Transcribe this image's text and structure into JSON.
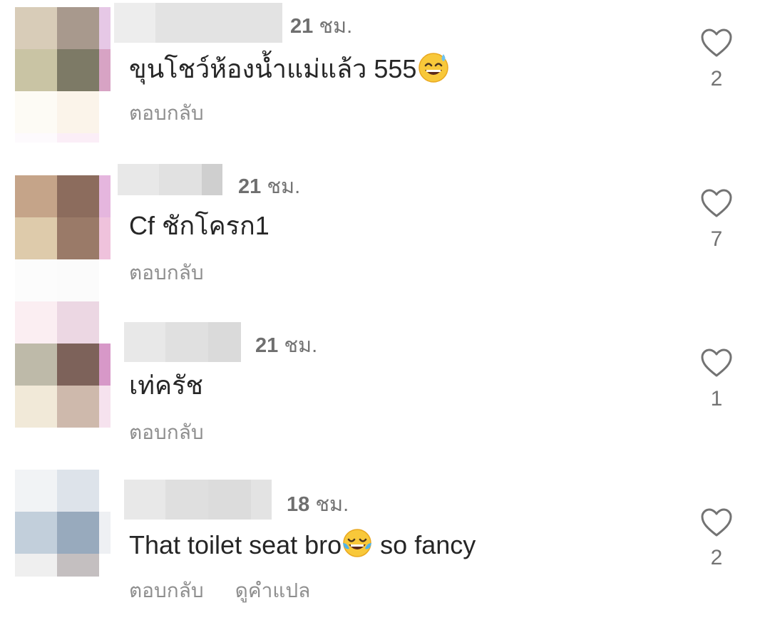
{
  "comments": [
    {
      "time_number": "21",
      "time_unit": "ชม.",
      "text": "ขุนโชว์ห้องน้ำแม่แล้ว 555",
      "emoji": "sweat-smile-emoji",
      "actions": {
        "reply": "ตอบกลับ"
      },
      "likes": "2"
    },
    {
      "time_number": "21",
      "time_unit": "ชม.",
      "text": "Cf ชักโครก1",
      "actions": {
        "reply": "ตอบกลับ"
      },
      "likes": "7"
    },
    {
      "time_number": "21",
      "time_unit": "ชม.",
      "text": "เท่ครัช",
      "actions": {
        "reply": "ตอบกลับ"
      },
      "likes": "1"
    },
    {
      "time_number": "18",
      "time_unit": "ชม.",
      "text_before_emoji": "That toilet seat bro",
      "emoji": "tears-of-joy-emoji",
      "text_after_emoji": " so fancy",
      "actions": {
        "reply": "ตอบกลับ",
        "translate": "ดูคำแปล"
      },
      "likes": "2"
    }
  ],
  "icons": {
    "like": "heart-outline-icon"
  },
  "colors": {
    "text_primary": "#262626",
    "text_secondary": "#8e8e8e",
    "background": "#ffffff"
  }
}
